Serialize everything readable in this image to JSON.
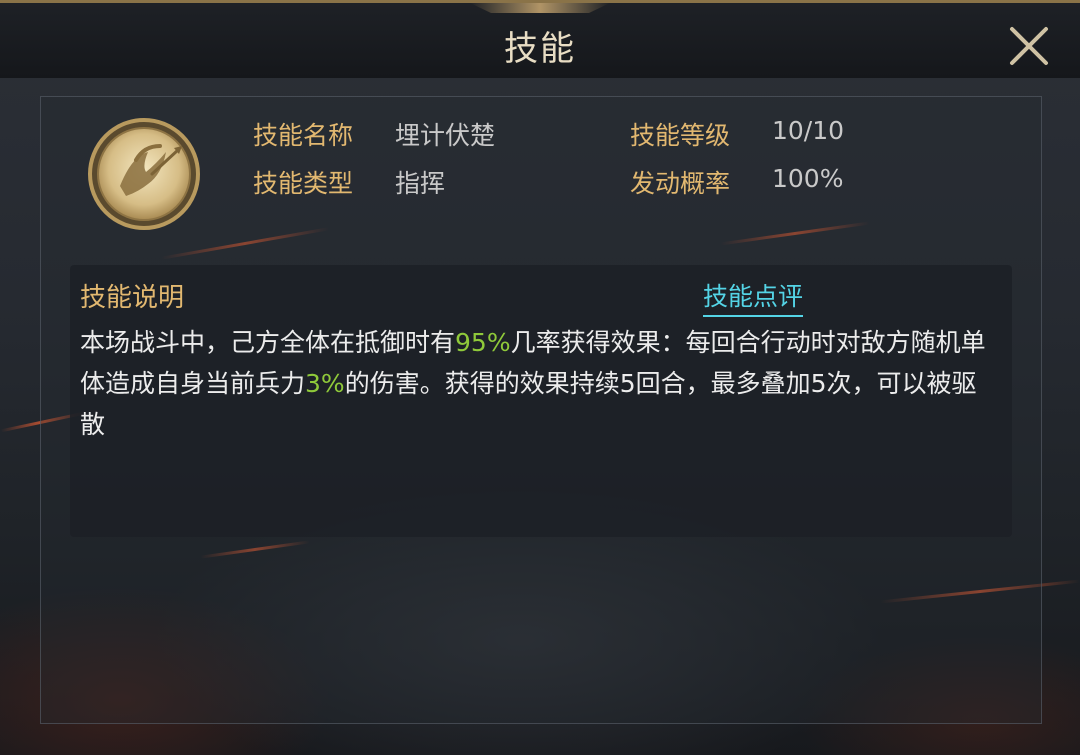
{
  "window": {
    "title": "技能"
  },
  "skill": {
    "name_label": "技能名称",
    "name_value": "埋计伏楚",
    "type_label": "技能类型",
    "type_value": "指挥",
    "level_label": "技能等级",
    "level_value": "10/10",
    "chance_label": "发动概率",
    "chance_value": "100%"
  },
  "description": {
    "title": "技能说明",
    "review_link": "技能点评",
    "seg1": "本场战斗中，己方全体在抵御时有",
    "seg2": "95%",
    "seg3": "几率获得效果：每回合行动时对敌方随机单体造成自身当前兵力",
    "seg4": "3%",
    "seg5": "的伤害。获得的效果持续5回合，最多叠加5次，可以被驱散"
  },
  "colors": {
    "label_gold": "#e2b870",
    "highlight_green": "#8fc93a",
    "link_cyan": "#54d4e6"
  },
  "icons": {
    "close": "close-icon",
    "skill": "skill-emblem-icon"
  }
}
